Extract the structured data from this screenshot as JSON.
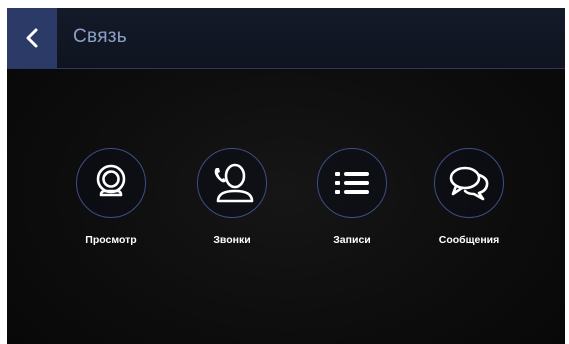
{
  "header": {
    "title": "Связь",
    "back_icon": "chevron-left-icon"
  },
  "colors": {
    "accent": "#2b3a66",
    "ring": "#3d4e86",
    "title": "#8fa0c8",
    "background": "#0d0d0d"
  },
  "tiles": [
    {
      "label": "Просмотр",
      "icon": "webcam-icon"
    },
    {
      "label": "Звонки",
      "icon": "caller-icon"
    },
    {
      "label": "Записи",
      "icon": "list-icon"
    },
    {
      "label": "Сообщения",
      "icon": "chat-bubbles-icon"
    }
  ]
}
